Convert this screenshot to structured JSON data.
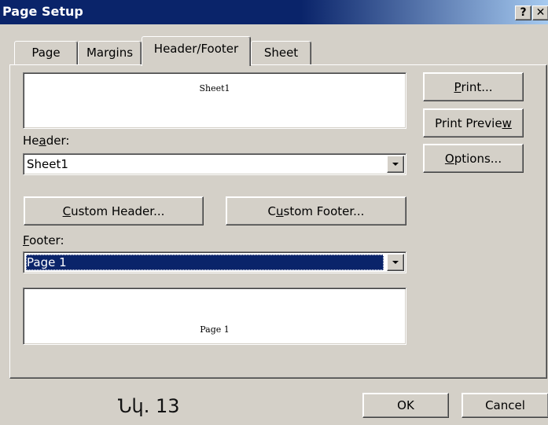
{
  "window": {
    "title": "Page Setup",
    "help_glyph": "?",
    "close_glyph": "✕"
  },
  "tabs": [
    {
      "label": "Page"
    },
    {
      "label": "Margins"
    },
    {
      "label": "Header/Footer",
      "active": true
    },
    {
      "label": "Sheet"
    }
  ],
  "header_preview": {
    "text": "Sheet1"
  },
  "header": {
    "label_pre": "He",
    "label_key": "a",
    "label_post": "der:",
    "value": "Sheet1"
  },
  "custom_header_button": {
    "pre": "",
    "key": "C",
    "post": "ustom Header..."
  },
  "custom_footer_button": {
    "pre": "C",
    "key": "u",
    "post": "stom Footer..."
  },
  "footer": {
    "label_pre": "",
    "label_key": "F",
    "label_post": "ooter:",
    "value": "Page 1"
  },
  "footer_preview": {
    "text": "Page 1"
  },
  "side_buttons": {
    "print": {
      "pre": "",
      "key": "P",
      "post": "rint..."
    },
    "print_preview": {
      "pre": "Print Previe",
      "key": "w",
      "post": ""
    },
    "options": {
      "pre": "",
      "key": "O",
      "post": "ptions..."
    }
  },
  "dialog_buttons": {
    "ok": "OK",
    "cancel": "Cancel"
  },
  "caption": "Նկ. 13"
}
